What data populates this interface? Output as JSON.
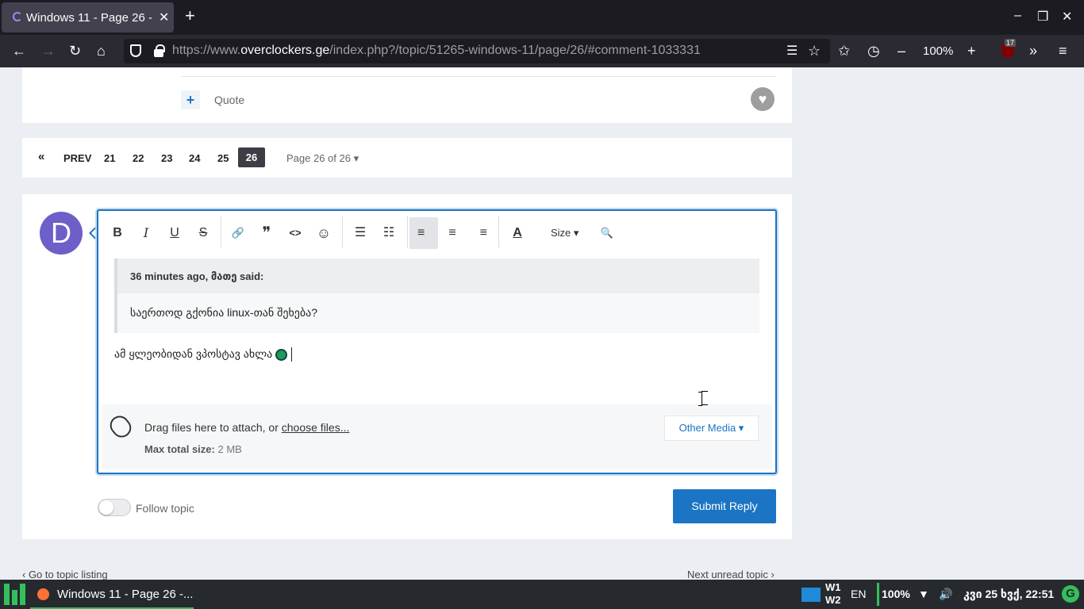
{
  "browser": {
    "tab_title": "Windows 11 - Page 26 - ...",
    "tab_close": "✕",
    "new_tab": "+",
    "url_prefix": "https://www.",
    "url_domain": "overclockers.ge",
    "url_path": "/index.php?/topic/51265-windows-11/page/26/#comment-1033331",
    "zoom_level": "100%",
    "ublock_count": "17",
    "window_controls": {
      "minimize": "–",
      "restore": "❐",
      "close": "✕"
    },
    "nav_icons": {
      "back": "←",
      "forward": "→",
      "reload": "↻",
      "home": "⌂",
      "reader": "☰",
      "bookmark": "☆",
      "collections": "✩",
      "history": "◷",
      "zoom_out": "–",
      "zoom_in": "+",
      "overflow": "»",
      "menu": "≡"
    }
  },
  "post": {
    "quote_label": "Quote",
    "plus_label": "+",
    "heart_icon": "♥"
  },
  "pagination": {
    "first": "«",
    "prev": "PREV",
    "pages": [
      "21",
      "22",
      "23",
      "24",
      "25"
    ],
    "current": "26",
    "info": "Page 26 of 26 ▾"
  },
  "reply": {
    "avatar_letter": "D",
    "toolbar": {
      "bold": "B",
      "italic": "I",
      "underline": "U",
      "strike": "S",
      "link": "🔗",
      "quote": "❞",
      "code": "<>",
      "emoji": "☺",
      "bullet_list": "☰",
      "numbered_list": "☷",
      "align_left": "≡",
      "align_center": "≡",
      "align_right": "≡",
      "font_color": "A",
      "size": "Size ▾",
      "preview": "🔍"
    },
    "quote_header": "36 minutes ago, მათე said:",
    "quote_body": "საერთოდ გქონია linux-თან შეხება?",
    "typed_text": "ამ ყლეობიდან ვპოსტავ ახლა",
    "attach": {
      "text": "Drag files here to attach, or ",
      "link": "choose files...",
      "max_label": "Max total size:",
      "max_value": " 2 MB",
      "other_media": "Other Media ▾"
    },
    "follow_label": "Follow topic",
    "submit_label": "Submit Reply"
  },
  "footer_nav": {
    "go_to_listing": "‹  Go to topic listing",
    "next_unread": "Next unread topic  ›"
  },
  "taskbar": {
    "task_label": "Windows 11 - Page 26 -...",
    "ws1": "W1",
    "ws2": "W2",
    "lang": "EN",
    "battery": "100%",
    "wifi_icon": "▼",
    "volume_icon": "🔊",
    "clock": "კვი 25 ხვქ, 22:51",
    "update_icon": "G"
  }
}
